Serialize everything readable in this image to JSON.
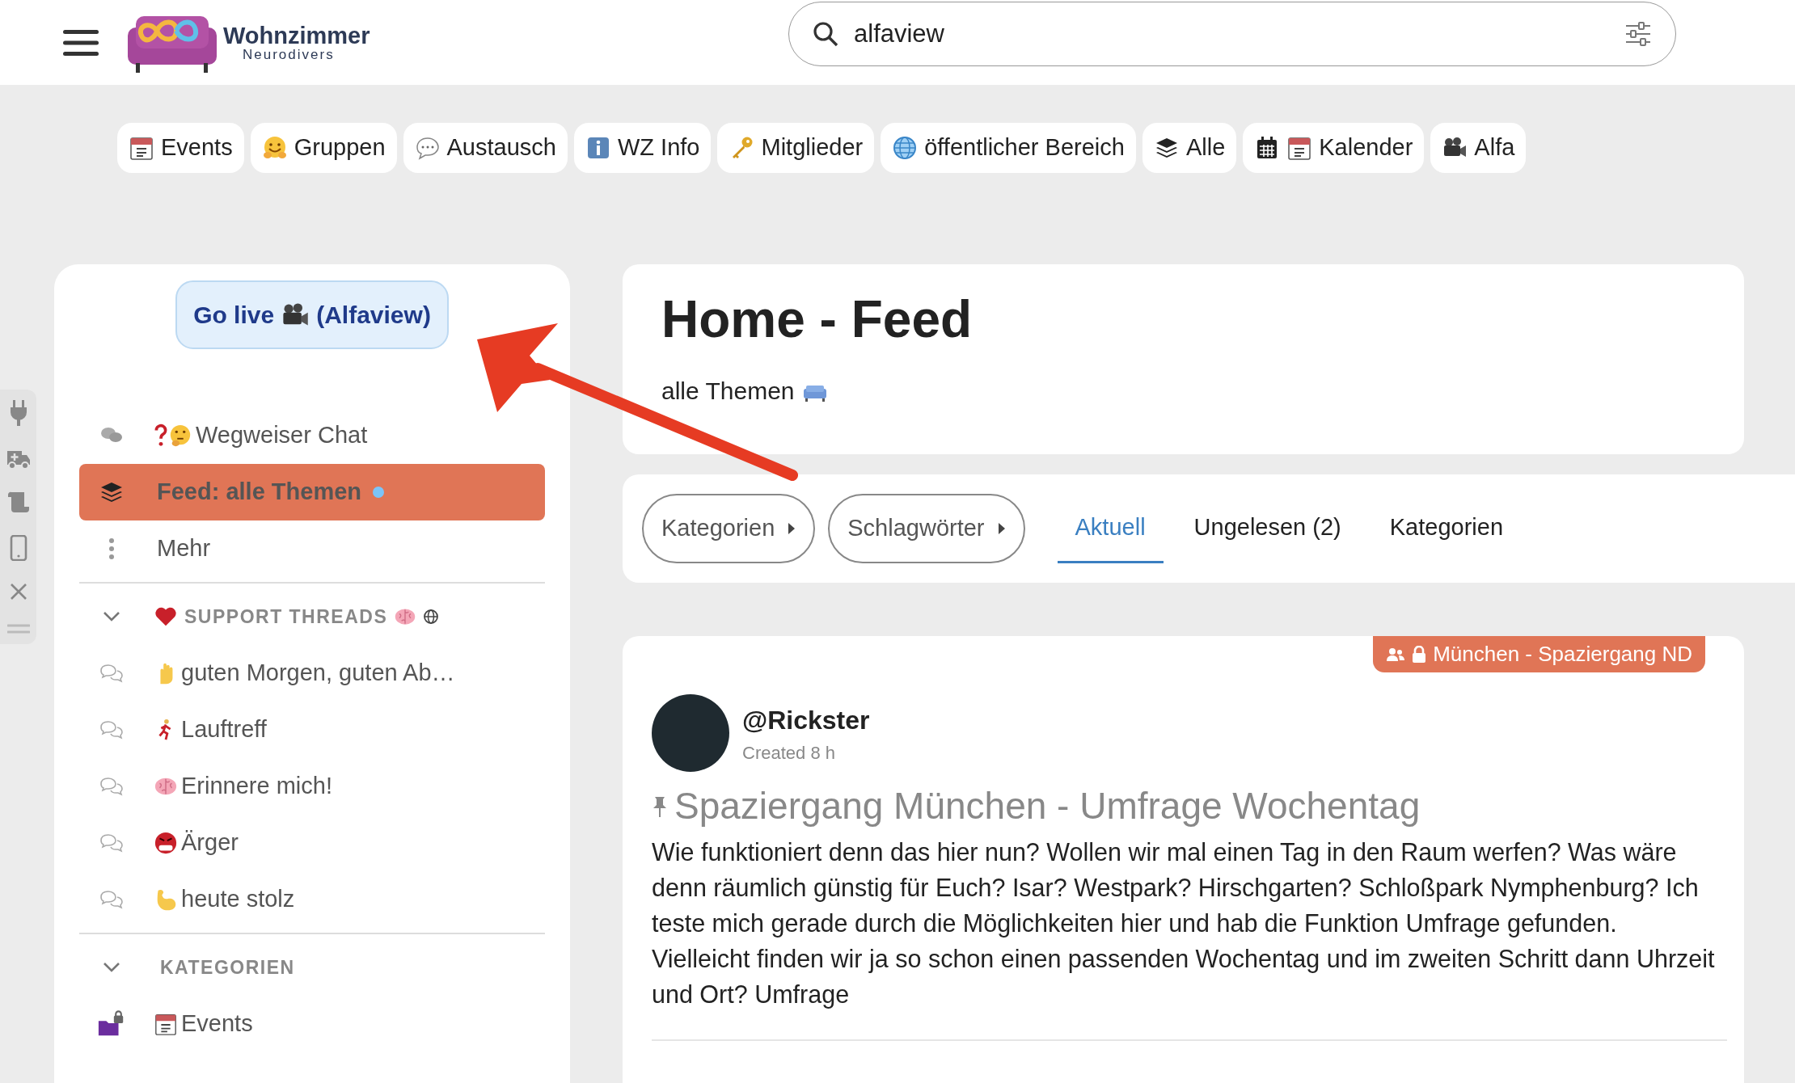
{
  "header": {
    "logo": {
      "title": "Wohnzimmer",
      "subtitle": "Neurodivers"
    },
    "search": {
      "value": "alfaview"
    }
  },
  "nav_chips": [
    {
      "label": "Events",
      "kind": "events"
    },
    {
      "label": "Gruppen",
      "kind": "groups"
    },
    {
      "label": "Austausch",
      "kind": "exchange"
    },
    {
      "label": "WZ Info",
      "kind": "info"
    },
    {
      "label": "Mitglieder",
      "kind": "members"
    },
    {
      "label": "öffentlicher Bereich",
      "kind": "public"
    },
    {
      "label": "Alle",
      "kind": "all"
    },
    {
      "label": "Kalender",
      "kind": "calendar"
    },
    {
      "label": "Alfa",
      "kind": "video"
    }
  ],
  "sidebar": {
    "go_live": {
      "text_before": "Go live",
      "text_after": "(Alfaview)"
    },
    "items": [
      {
        "label": "Wegweiser Chat",
        "kind": "guide",
        "selected": false,
        "unread": false
      },
      {
        "label": "Feed: alle Themen",
        "kind": "feed",
        "selected": true,
        "unread": true
      },
      {
        "label": "Mehr",
        "kind": "more",
        "selected": false,
        "unread": false
      }
    ],
    "sections": [
      {
        "title": "SUPPORT THREADS",
        "kind": "support",
        "expanded": true,
        "items": [
          {
            "label": "guten Morgen, guten Ab…",
            "kind": "hand"
          },
          {
            "label": "Lauftreff",
            "kind": "runner"
          },
          {
            "label": "Erinnere mich!",
            "kind": "brain"
          },
          {
            "label": "Ärger",
            "kind": "angry"
          },
          {
            "label": "heute stolz",
            "kind": "muscle"
          }
        ]
      },
      {
        "title": "KATEGORIEN",
        "kind": "categories",
        "expanded": true,
        "items": [
          {
            "label": "Events",
            "kind": "events"
          }
        ]
      }
    ]
  },
  "feed_header": {
    "title": "Home - Feed",
    "subtitle": "alle Themen"
  },
  "filters": [
    {
      "label": "Kategorien"
    },
    {
      "label": "Schlagwörter"
    }
  ],
  "tabs": [
    {
      "label": "Aktuell",
      "selected": true
    },
    {
      "label": "Ungelesen (2)",
      "selected": false
    },
    {
      "label": "Kategorien",
      "selected": false
    }
  ],
  "post": {
    "group_badge": "München - Spaziergang ND",
    "author": "@Rickster",
    "created": "Created 8 h",
    "pinned": true,
    "title": "Spaziergang München - Umfrage Wochentag",
    "body": "Wie funktioniert denn das hier nun? Wollen wir mal einen Tag in den Raum werfen? Was wäre denn räumlich günstig für Euch? Isar? Westpark? Hirschgarten? Schloßpark Nymphenburg? Ich teste mich gerade durch die Möglichkeiten hier und hab die Funktion Umfrage gefunden. Vielleicht finden wir ja so schon einen passenden Wochentag und im zweiten Schritt dann Uhrzeit und Ort? Umfrage"
  }
}
